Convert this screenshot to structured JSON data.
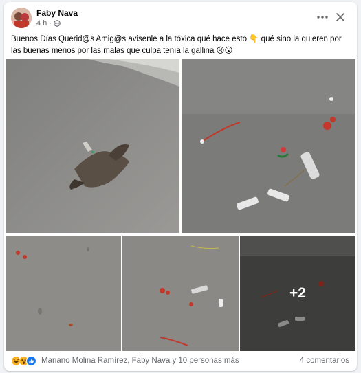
{
  "post": {
    "author": "Faby Nava",
    "time": "4 h",
    "visibility_icon": "globe-icon",
    "text": "Buenos Días Querid@s Amig@s avisenle a la tóxica qué hace esto 👇  qué sino la quieren por las buenas menos por las malas que culpa tenía la gallina 😩😮"
  },
  "photos": {
    "more_count": "+2"
  },
  "footer": {
    "reaction_icons": [
      "haha-icon",
      "wow-icon",
      "like-icon"
    ],
    "reactions_text": "Mariano Molina Ramírez, Faby Nava y 10 personas más",
    "comments_text": "4 comentarios"
  },
  "colors": {
    "sand": "#8e8d8a",
    "wet_sand": "#6f6f6d",
    "text_secondary": "#65676b",
    "haha": "#f7b125",
    "like": "#1877f2"
  }
}
